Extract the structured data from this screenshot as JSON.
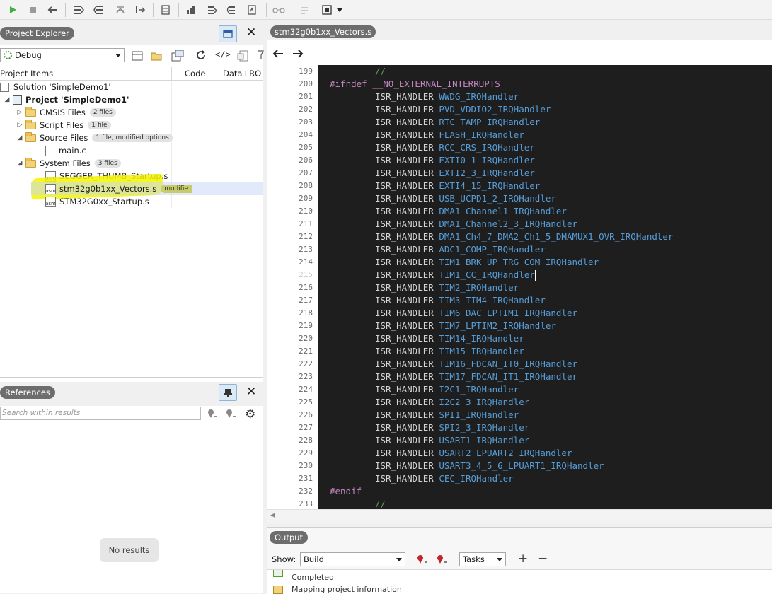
{
  "editor_tab": "stm32g0b1xx_Vectors.s",
  "project_explorer": {
    "title": "Project Explorer",
    "configuration": "Debug",
    "columns": [
      "Project Items",
      "Code",
      "Data+RO"
    ],
    "tree": [
      {
        "label": "Solution 'SimpleDemo1'",
        "badge": ""
      },
      {
        "label": "Project 'SimpleDemo1'",
        "badge": ""
      },
      {
        "label": "CMSIS Files",
        "badge": "2 files"
      },
      {
        "label": "Script Files",
        "badge": "1 file"
      },
      {
        "label": "Source Files",
        "badge": "1 file, modified options"
      },
      {
        "label": "main.c",
        "badge": ""
      },
      {
        "label": "System Files",
        "badge": "3 files"
      },
      {
        "label": "SEGGER_THUMB_Startup.s",
        "badge": ""
      },
      {
        "label": "stm32g0b1xx_Vectors.s",
        "badge": "modifie"
      },
      {
        "label": "STM32G0xx_Startup.s",
        "badge": ""
      }
    ]
  },
  "references": {
    "title": "References",
    "search_placeholder": "Search within results",
    "empty_text": "No results"
  },
  "code": {
    "line_numbers": [
      "199",
      "200",
      "201",
      "202",
      "203",
      "204",
      "205",
      "206",
      "207",
      "208",
      "209",
      "210",
      "211",
      "212",
      "213",
      "214",
      "215",
      "216",
      "217",
      "218",
      "219",
      "220",
      "221",
      "222",
      "223",
      "224",
      "225",
      "226",
      "227",
      "228",
      "229",
      "230",
      "231",
      "232",
      "233"
    ],
    "comment_slashes": "//",
    "ifndef": "#ifndef",
    "ifndef_arg": "__NO_EXTERNAL_INTERRUPTS",
    "endif": "#endif",
    "macro": "ISR_HANDLER",
    "handlers": [
      "WWDG_IRQHandler",
      "PVD_VDDIO2_IRQHandler",
      "RTC_TAMP_IRQHandler",
      "FLASH_IRQHandler",
      "RCC_CRS_IRQHandler",
      "EXTI0_1_IRQHandler",
      "EXTI2_3_IRQHandler",
      "EXTI4_15_IRQHandler",
      "USB_UCPD1_2_IRQHandler",
      "DMA1_Channel1_IRQHandler",
      "DMA1_Channel2_3_IRQHandler",
      "DMA1_Ch4_7_DMA2_Ch1_5_DMAMUX1_OVR_IRQHandler",
      "ADC1_COMP_IRQHandler",
      "TIM1_BRK_UP_TRG_COM_IRQHandler",
      "TIM1_CC_IRQHandler",
      "TIM2_IRQHandler",
      "TIM3_TIM4_IRQHandler",
      "TIM6_DAC_LPTIM1_IRQHandler",
      "TIM7_LPTIM2_IRQHandler",
      "TIM14_IRQHandler",
      "TIM15_IRQHandler",
      "TIM16_FDCAN_IT0_IRQHandler",
      "TIM17_FDCAN_IT1_IRQHandler",
      "I2C1_IRQHandler",
      "I2C2_3_IRQHandler",
      "SPI1_IRQHandler",
      "SPI2_3_IRQHandler",
      "USART1_IRQHandler",
      "USART2_LPUART2_IRQHandler",
      "USART3_4_5_6_LPUART1_IRQHandler",
      "CEC_IRQHandler"
    ]
  },
  "output": {
    "title": "Output",
    "show_label": "Show:",
    "show_value": "Build",
    "tasks_value": "Tasks",
    "messages": [
      "Completed",
      "Mapping project information"
    ]
  },
  "colors": {
    "highlight": "#f5f500",
    "code_bg": "#1e1e1e",
    "keyword": "#c586c0",
    "handler": "#569cd6",
    "comment": "#6a9955"
  }
}
